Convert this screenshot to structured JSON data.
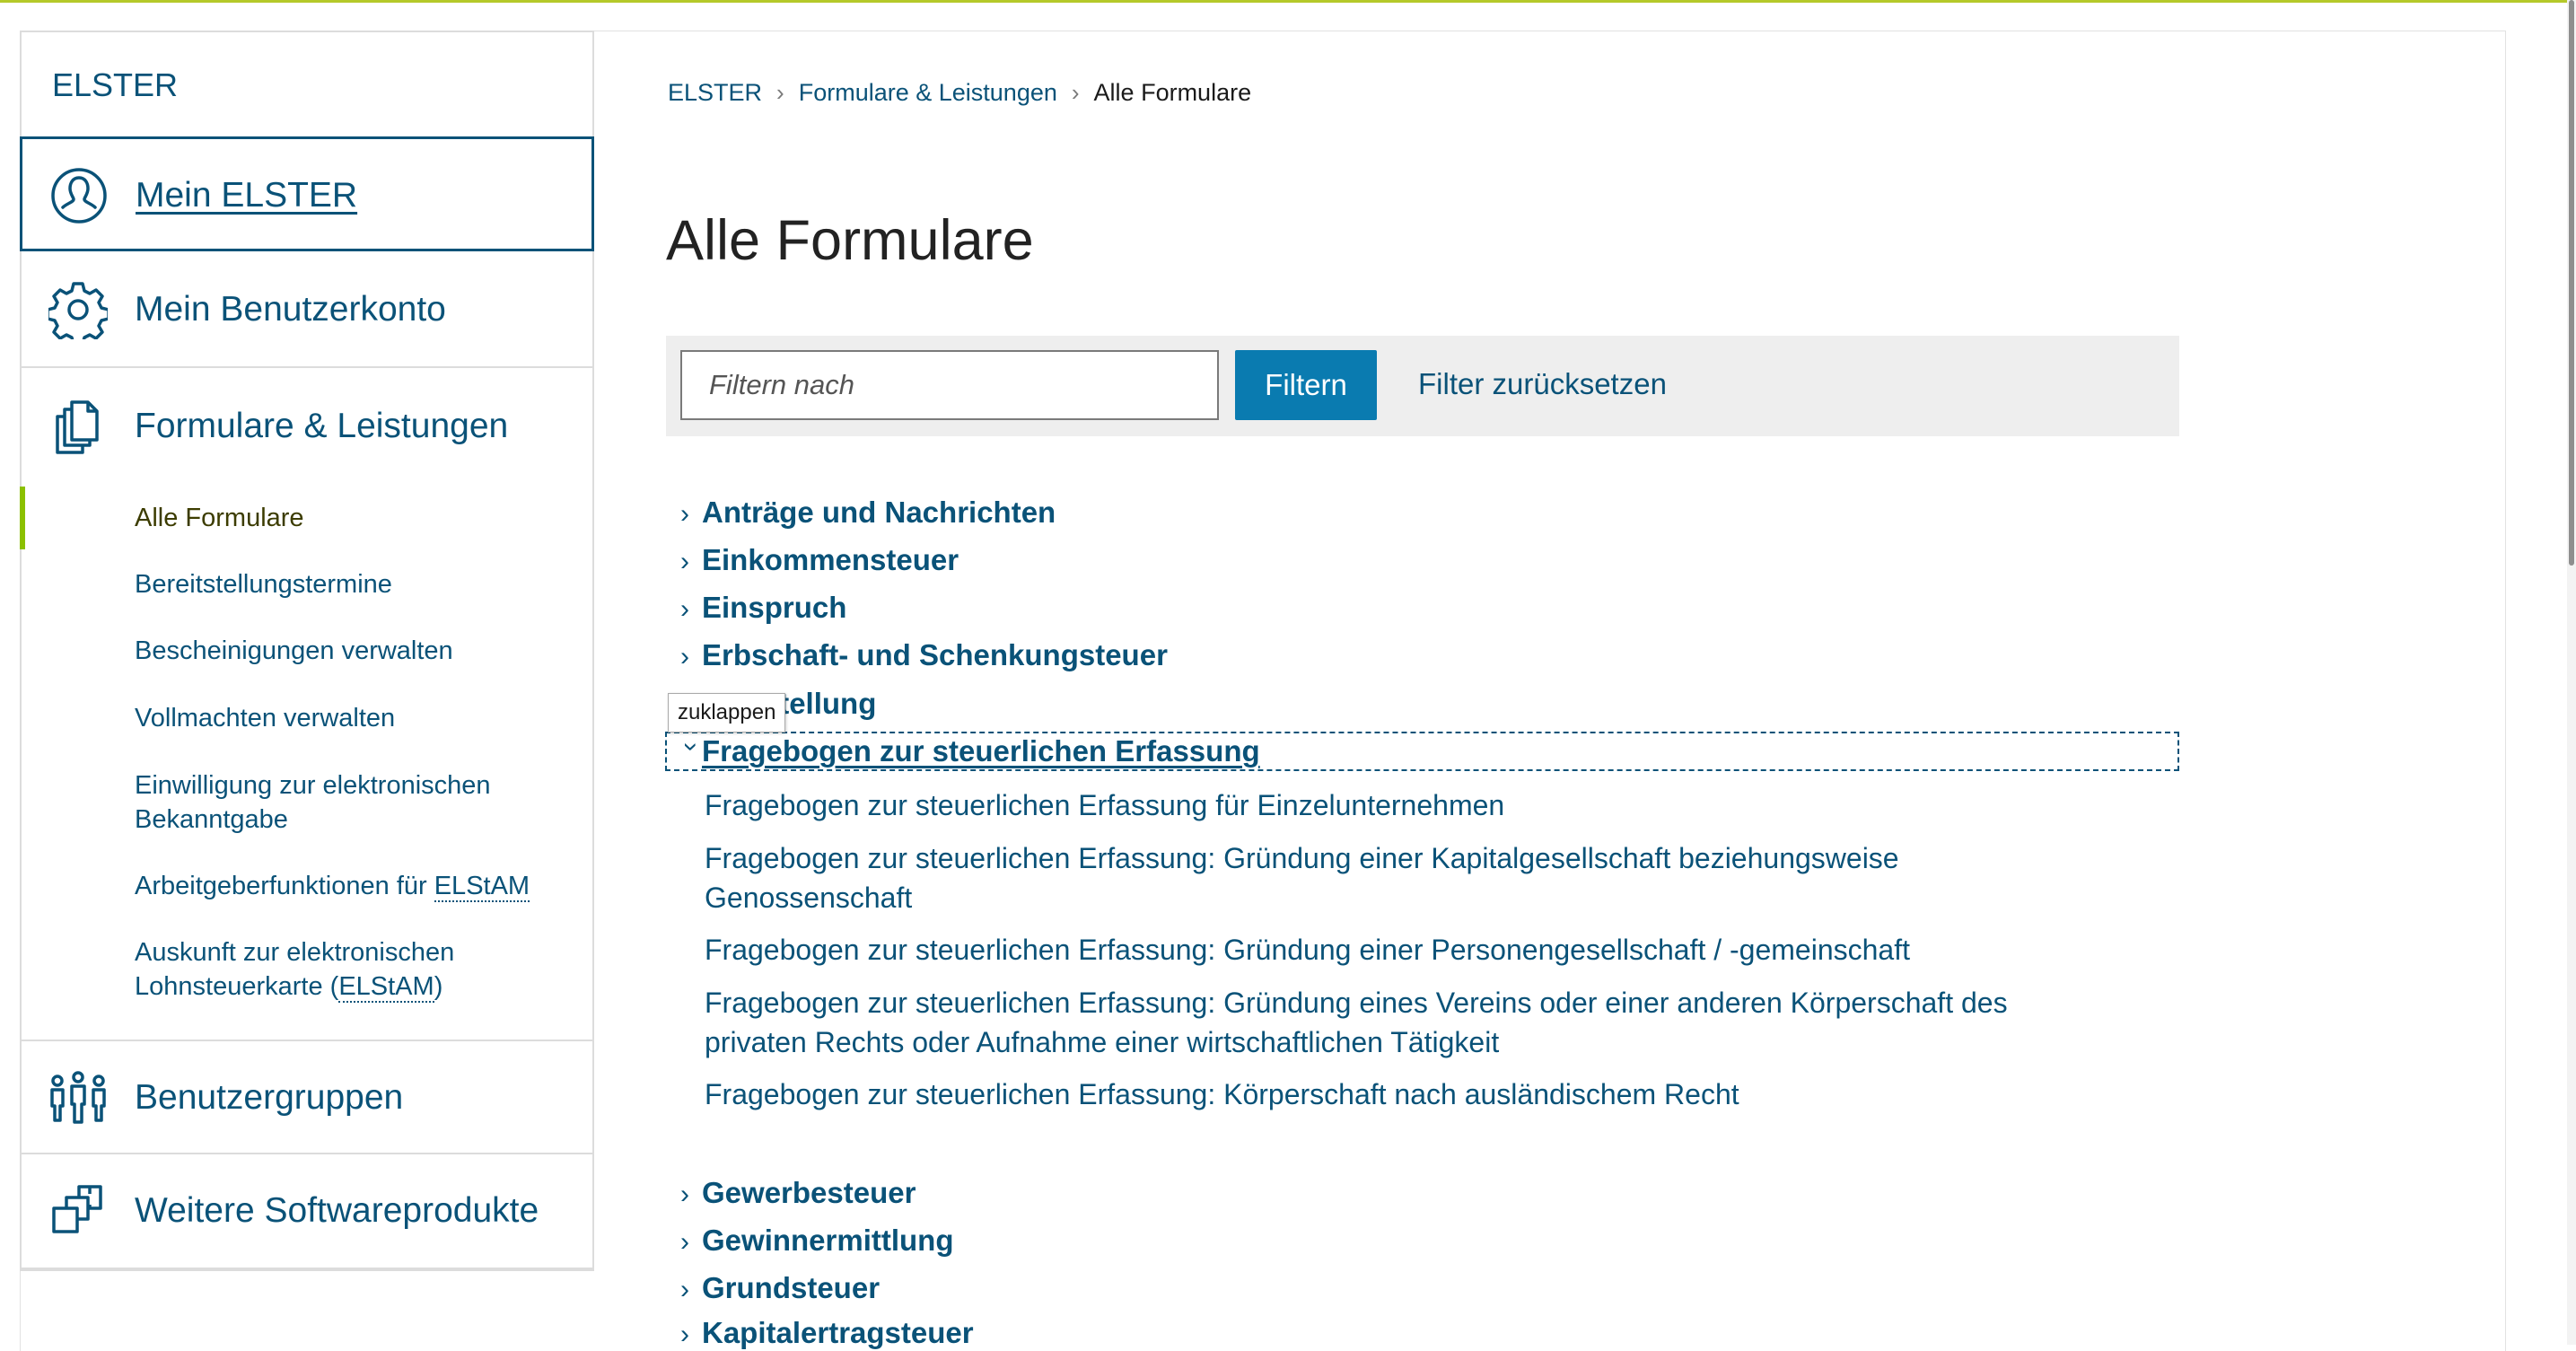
{
  "sidebar": {
    "header": "ELSTER",
    "items": [
      {
        "label": "Mein ELSTER"
      },
      {
        "label": "Mein Benutzerkonto"
      },
      {
        "label": "Formulare & Leistungen"
      },
      {
        "label": "Benutzergruppen"
      },
      {
        "label": "Weitere Softwareprodukte"
      }
    ],
    "sub_items": [
      {
        "label": "Alle Formulare"
      },
      {
        "label": "Bereitstellungstermine"
      },
      {
        "label": "Bescheinigungen verwalten"
      },
      {
        "label": "Vollmachten verwalten"
      },
      {
        "label": "Einwilligung zur elektronischen Bekanntgabe"
      },
      {
        "label_prefix": "Arbeitgeberfunktionen für ",
        "label_abbr": "ELStAM"
      },
      {
        "label_prefix": "Auskunft zur elektronischen Lohnsteuerkarte (",
        "label_abbr": "ELStAM",
        "label_suffix": ")"
      }
    ]
  },
  "breadcrumb": [
    "ELSTER",
    "Formulare & Leistungen",
    "Alle Formulare"
  ],
  "page_title": "Alle Formulare",
  "filter": {
    "placeholder": "Filtern nach",
    "button": "Filtern",
    "reset": "Filter zurücksetzen"
  },
  "categories_top": [
    "Anträge und Nachrichten",
    "Einkommensteuer",
    "Einspruch",
    "Erbschaft- und Schenkungsteuer",
    "Feststellung"
  ],
  "expanded_category": "Fragebogen zur steuerlichen Erfassung",
  "tooltip": "zuklappen",
  "expanded_forms": [
    "Fragebogen zur steuerlichen Erfassung für Einzelunternehmen",
    "Fragebogen zur steuerlichen Erfassung: Gründung einer Kapitalgesellschaft beziehungsweise Genossenschaft",
    "Fragebogen zur steuerlichen Erfassung: Gründung einer Personengesellschaft / -gemeinschaft",
    "Fragebogen zur steuerlichen Erfassung: Gründung eines Vereins oder einer anderen Körperschaft des privaten Rechts oder Aufnahme einer wirtschaftlichen Tätigkeit",
    "Fragebogen zur steuerlichen Erfassung: Körperschaft nach ausländischem Recht"
  ],
  "categories_bottom": [
    "Gewerbesteuer",
    "Gewinnermittlung",
    "Grundsteuer",
    "Kapitalertragsteuer"
  ],
  "colors": {
    "brand_blue": "#0a5278",
    "button_blue": "#0a7bb0",
    "active_marker": "#8bc000"
  }
}
